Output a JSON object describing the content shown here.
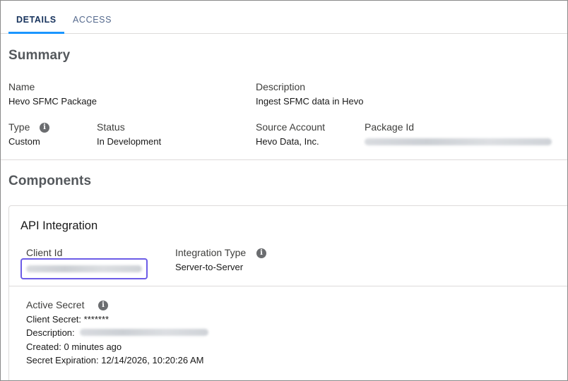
{
  "tabs": [
    {
      "label": "DETAILS",
      "active": true
    },
    {
      "label": "ACCESS",
      "active": false
    }
  ],
  "summary": {
    "title": "Summary",
    "name_label": "Name",
    "name_value": "Hevo SFMC Package",
    "description_label": "Description",
    "description_value": "Ingest SFMC data in Hevo",
    "type_label": "Type",
    "type_value": "Custom",
    "status_label": "Status",
    "status_value": "In Development",
    "source_account_label": "Source Account",
    "source_account_value": "Hevo Data, Inc.",
    "package_id_label": "Package Id"
  },
  "components": {
    "title": "Components",
    "api_integration": {
      "title": "API Integration",
      "client_id_label": "Client Id",
      "integration_type_label": "Integration Type",
      "integration_type_value": "Server-to-Server"
    },
    "active_secret": {
      "title": "Active Secret",
      "client_secret_text": "Client Secret: *******",
      "description_label": "Description:",
      "created_text": "Created: 0 minutes ago",
      "expiration_text": "Secret Expiration: 12/14/2026, 10:20:26 AM"
    }
  },
  "colors": {
    "accent": "#1b96ff",
    "focus_border": "#6c5ce7",
    "info_icon": "#6b6d70"
  },
  "icons": {
    "info": "info-circle-icon"
  }
}
